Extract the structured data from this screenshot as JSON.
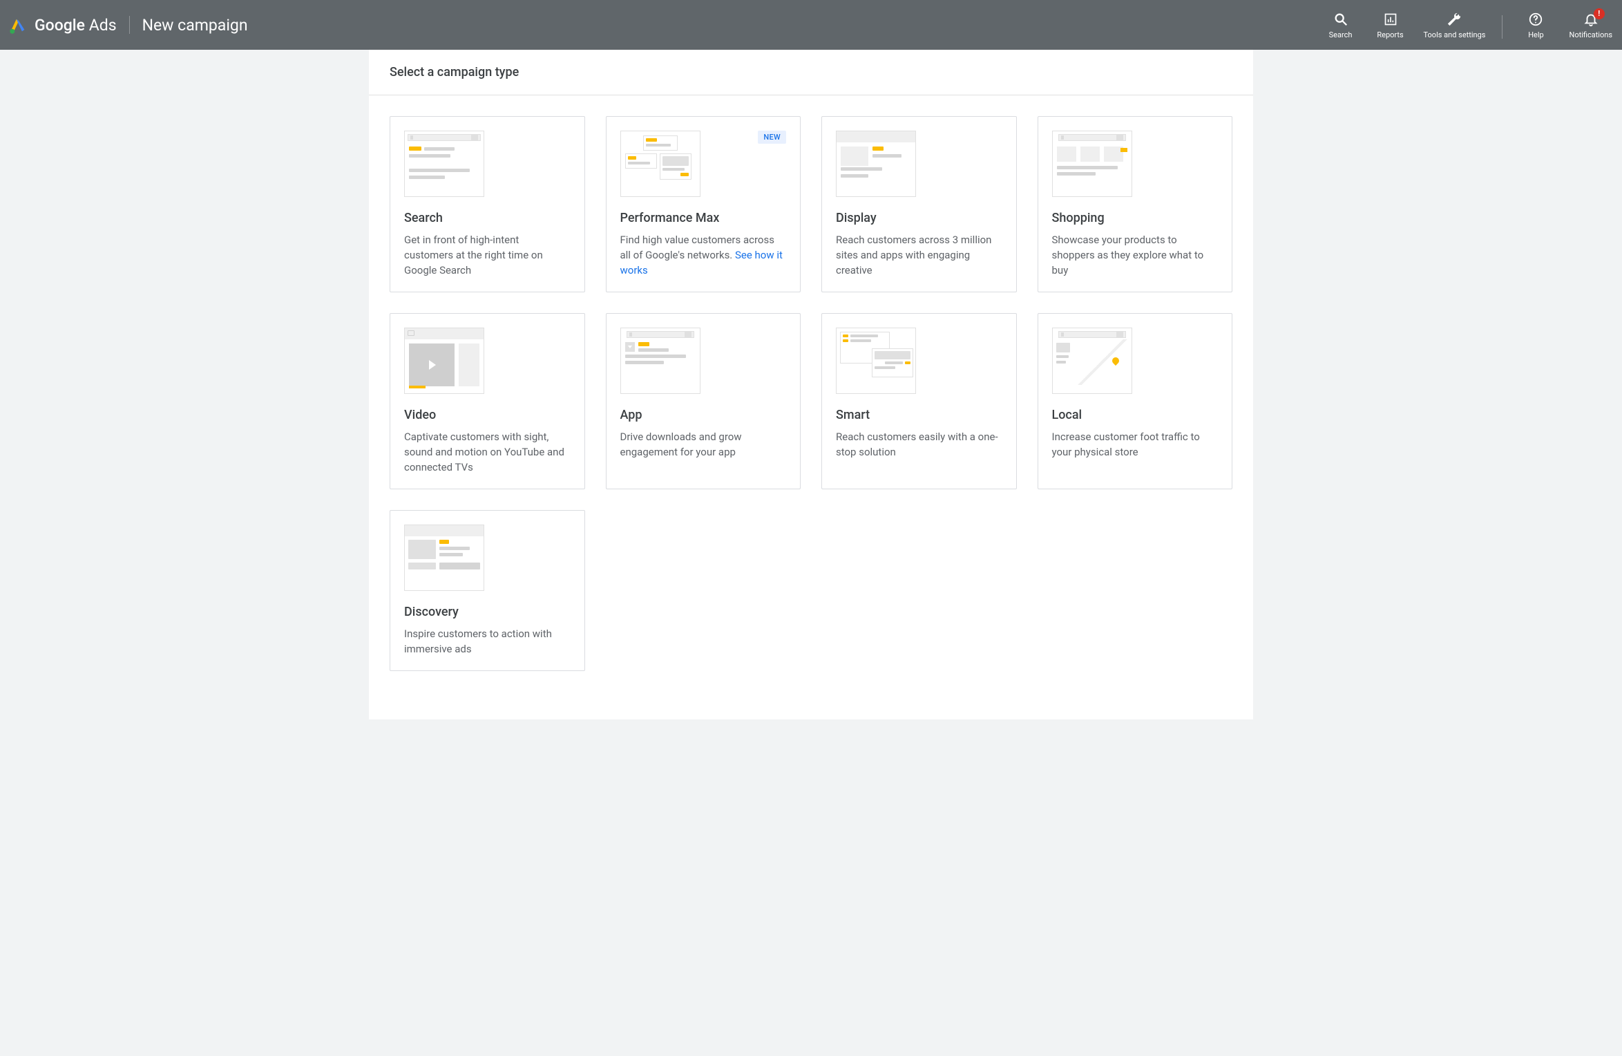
{
  "header": {
    "brand_bold": "Google",
    "brand_light": "Ads",
    "page_title": "New campaign",
    "nav": {
      "search": "Search",
      "reports": "Reports",
      "tools": "Tools and settings",
      "help": "Help",
      "notifications": "Notifications",
      "notification_badge": "!"
    }
  },
  "section_title": "Select a campaign type",
  "cards": {
    "search": {
      "title": "Search",
      "desc": "Get in front of high-intent customers at the right time on Google Search"
    },
    "pmax": {
      "title": "Performance Max",
      "desc_prefix": "Find high value customers across all of Google's networks. ",
      "link": "See how it works",
      "badge": "NEW"
    },
    "display": {
      "title": "Display",
      "desc": "Reach customers across 3 million sites and apps with engaging creative"
    },
    "shopping": {
      "title": "Shopping",
      "desc": "Showcase your products to shoppers as they explore what to buy"
    },
    "video": {
      "title": "Video",
      "desc": "Captivate customers with sight, sound and motion on YouTube and connected TVs"
    },
    "app": {
      "title": "App",
      "desc": "Drive downloads and grow engagement for your app"
    },
    "smart": {
      "title": "Smart",
      "desc": "Reach customers easily with a one-stop solution"
    },
    "local": {
      "title": "Local",
      "desc": "Increase customer foot traffic to your physical store"
    },
    "discovery": {
      "title": "Discovery",
      "desc": "Inspire customers to action with immersive ads"
    }
  }
}
